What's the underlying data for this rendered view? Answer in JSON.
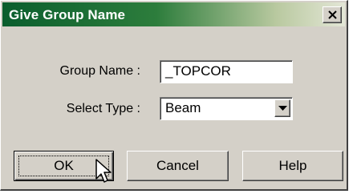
{
  "window": {
    "title": "Give Group Name",
    "close_symbol": "✕"
  },
  "form": {
    "group_name_label": "Group Name :",
    "group_name_value": "_TOPCOR",
    "select_type_label": "Select Type :",
    "select_type_value": "Beam"
  },
  "buttons": {
    "ok": "OK",
    "cancel": "Cancel",
    "help": "Help"
  },
  "icons": {
    "dropdown": "chevron-down-icon",
    "close": "close-icon",
    "cursor": "mouse-pointer-icon"
  },
  "colors": {
    "title_start": "#0a5e2e",
    "title_end": "#e3e6d6",
    "face": "#d4d0c8"
  }
}
